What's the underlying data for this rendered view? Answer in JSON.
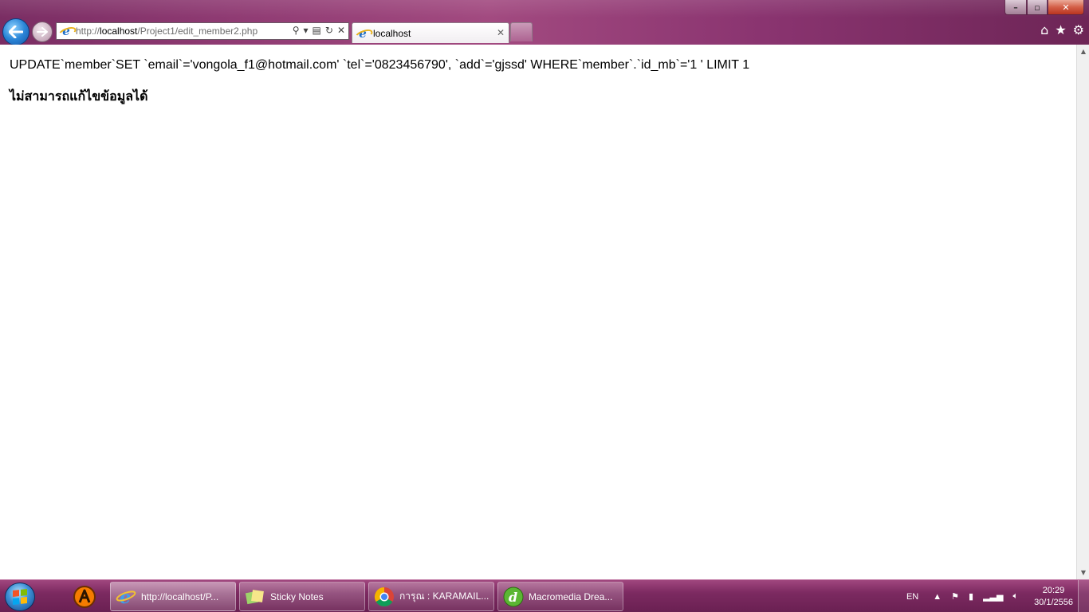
{
  "browser": {
    "address_url_prefix": "http://",
    "address_url_host": "localhost",
    "address_url_path": "/Project1/edit_member2.php",
    "tab_title": "localhost"
  },
  "page": {
    "sql_text": "UPDATE`member`SET `email`='vongola_f1@hotmail.com' `tel`='0823456790', `add`='gjssd' WHERE`member`.`id_mb`='1 ' LIMIT 1",
    "error_text": "ไม่สามารถแก้ไขข้อมูลได้"
  },
  "taskbar": {
    "items": [
      {
        "label": "http://localhost/P...",
        "icon": "ie-icon"
      },
      {
        "label": "Sticky Notes",
        "icon": "sticky-notes-icon"
      },
      {
        "label": "การุณ : KARAMAIL...",
        "icon": "chrome-icon"
      },
      {
        "label": "Macromedia Drea...",
        "icon": "dreamweaver-icon"
      }
    ],
    "language": "EN",
    "time": "20:29",
    "date": "30/1/2556"
  },
  "colors": {
    "chrome_accent": "#8e3a72",
    "taskbar": "#7c2a61"
  }
}
